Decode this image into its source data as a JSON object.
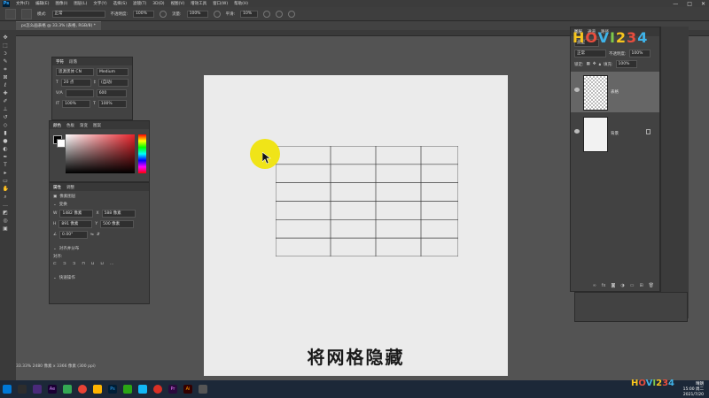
{
  "menu": {
    "logo": "Ps",
    "items": [
      "文件(F)",
      "编辑(E)",
      "图像(I)",
      "图层(L)",
      "文字(Y)",
      "选择(S)",
      "滤镜(T)",
      "3D(D)",
      "视图(V)",
      "增效工具",
      "窗口(W)",
      "帮助(H)"
    ]
  },
  "window_controls": [
    "—",
    "□",
    "✕"
  ],
  "options": {
    "mode_label": "模式:",
    "mode_value": "正常",
    "opacity_label": "不透明度:",
    "opacity_value": "100%",
    "flow_label": "流量:",
    "flow_value": "100%",
    "smooth_label": "平滑:",
    "smooth_value": "10%"
  },
  "document": {
    "tab_title": "ps怎么画表格 @ 33.3% (表格, RGB/8) *",
    "subtitle": "将网格隐藏",
    "status": "33.33%  2480 像素 x 3366 像素 (300 ppi)"
  },
  "char_panel": {
    "tabs": [
      "字符",
      "段落"
    ],
    "font": "思源黑体 CN",
    "style": "Medium",
    "size": "20 点",
    "leading": "(自动)",
    "tracking": "600",
    "scale_v": "100%",
    "scale_h": "100%"
  },
  "color_panel": {
    "tabs": [
      "颜色",
      "色板",
      "渐变",
      "图案"
    ],
    "accent": "#e8232b"
  },
  "props_panel": {
    "tabs": [
      "属性",
      "调整"
    ],
    "kind": "像素图层",
    "section_transform": "变换",
    "w_label": "W",
    "w_value": "1482 像素",
    "x_label": "X",
    "x_value": "588 像素",
    "h_label": "H",
    "h_value": "891 像素",
    "y_label": "Y",
    "y_value": "500 像素",
    "angle": "0.00°",
    "section_align": "对齐并分布",
    "align_label": "对齐:",
    "section_quick": "快速操作"
  },
  "layers_panel": {
    "tabs": [
      "图层",
      "通道",
      "路径"
    ],
    "kind_label": "类型",
    "blend": "正常",
    "opacity_label": "不透明度:",
    "opacity_value": "100%",
    "lock_label": "锁定:",
    "fill_label": "填充:",
    "fill_value": "100%",
    "layers": [
      {
        "name": "表格"
      },
      {
        "name": "背景"
      }
    ]
  },
  "watermark": {
    "text": "HOVI234",
    "small": "HOVI234"
  },
  "tray": {
    "weather": "晴朗",
    "temp": "15:00 周二",
    "date": "2021/7/20"
  },
  "taskbar_icons": [
    "Ae",
    "Ps",
    "Pr",
    "Ai"
  ]
}
